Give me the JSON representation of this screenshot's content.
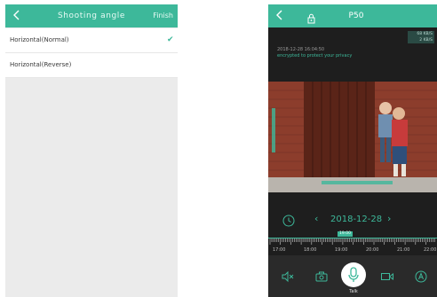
{
  "left_screen": {
    "header": {
      "back_icon": "chevron-left-icon",
      "title": "Shooting angle",
      "finish_label": "Finish"
    },
    "options": [
      {
        "label": "Horizontal(Normal)",
        "selected": true
      },
      {
        "label": "Horizontal(Reverse)",
        "selected": false
      }
    ],
    "check_glyph": "✔"
  },
  "right_screen": {
    "header": {
      "back_icon": "chevron-left-icon",
      "lock_icon": "lock-icon",
      "title": "P50"
    },
    "bitrate_line1": "68 KB/S",
    "bitrate_line2": "2 KB/S",
    "timestamp": "2018-12-28 16:04:50",
    "encrypted_notice": "encrypted to protect your privacy",
    "date_nav": {
      "prev": "‹",
      "date": "2018-12-28",
      "next": "›"
    },
    "timeline": {
      "current_marker": "19:00",
      "labels": [
        "17:00",
        "18:00",
        "19:00",
        "20:00",
        "21:00",
        "22:00"
      ]
    },
    "toolbar": {
      "talk_label": "Talk"
    },
    "colors": {
      "accent": "#3db89a",
      "dark_bg": "#1e1e1e"
    }
  }
}
